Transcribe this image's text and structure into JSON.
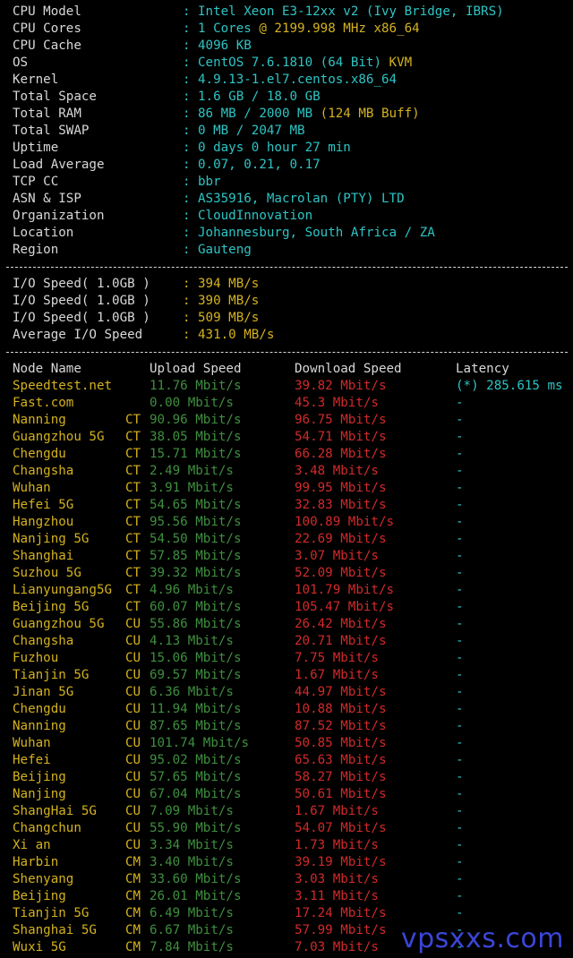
{
  "sysinfo": [
    {
      "key": "CPU Model",
      "value": "Intel Xeon E3-12xx v2 (Ivy Bridge, IBRS)",
      "extra": ""
    },
    {
      "key": "CPU Cores",
      "value": "1 Cores",
      "extra": "@ 2199.998 MHz x86_64"
    },
    {
      "key": "CPU Cache",
      "value": "4096 KB",
      "extra": ""
    },
    {
      "key": "OS",
      "value": "CentOS 7.6.1810 (64 Bit)",
      "extra": "KVM"
    },
    {
      "key": "Kernel",
      "value": "4.9.13-1.el7.centos.x86_64",
      "extra": ""
    },
    {
      "key": "Total Space",
      "value": "1.6 GB / 18.0 GB",
      "extra": ""
    },
    {
      "key": "Total RAM",
      "value": "86 MB / 2000 MB",
      "extra": "(124 MB Buff)"
    },
    {
      "key": "Total SWAP",
      "value": "0 MB / 2047 MB",
      "extra": ""
    },
    {
      "key": "Uptime",
      "value": "0 days 0 hour 27 min",
      "extra": ""
    },
    {
      "key": "Load Average",
      "value": "0.07, 0.21, 0.17",
      "extra": ""
    },
    {
      "key": "TCP CC",
      "value": "bbr",
      "extra": ""
    },
    {
      "key": "ASN & ISP",
      "value": "AS35916, Macrolan (PTY) LTD",
      "extra": ""
    },
    {
      "key": "Organization",
      "value": "CloudInnovation",
      "extra": ""
    },
    {
      "key": "Location",
      "value": "Johannesburg, South Africa / ZA",
      "extra": ""
    },
    {
      "key": "Region",
      "value": "Gauteng",
      "extra": ""
    }
  ],
  "io": [
    {
      "key": "I/O Speed( 1.0GB )",
      "value": "394 MB/s"
    },
    {
      "key": "I/O Speed( 1.0GB )",
      "value": "390 MB/s"
    },
    {
      "key": "I/O Speed( 1.0GB )",
      "value": "509 MB/s"
    },
    {
      "key": "Average I/O Speed",
      "value": "431.0 MB/s"
    }
  ],
  "separator": ":",
  "speed_headers": {
    "node": "Node Name",
    "upload": "Upload Speed",
    "download": "Download Speed",
    "latency": "Latency"
  },
  "speed_rows": [
    {
      "node": "Speedtest.net",
      "isp": "",
      "up": "11.76 Mbit/s",
      "down": "39.82 Mbit/s",
      "lat": "(*) 285.615 ms"
    },
    {
      "node": "Fast.com",
      "isp": "",
      "up": "0.00 Mbit/s",
      "down": "45.3 Mbit/s",
      "lat": "-"
    },
    {
      "node": "Nanning",
      "isp": "CT",
      "up": "90.96 Mbit/s",
      "down": "96.75 Mbit/s",
      "lat": "-"
    },
    {
      "node": "Guangzhou 5G",
      "isp": "CT",
      "up": "38.05 Mbit/s",
      "down": "54.71 Mbit/s",
      "lat": "-"
    },
    {
      "node": "Chengdu",
      "isp": "CT",
      "up": "15.71 Mbit/s",
      "down": "66.28 Mbit/s",
      "lat": "-"
    },
    {
      "node": "Changsha",
      "isp": "CT",
      "up": "2.49 Mbit/s",
      "down": "3.48 Mbit/s",
      "lat": "-"
    },
    {
      "node": "Wuhan",
      "isp": "CT",
      "up": "3.91 Mbit/s",
      "down": "99.95 Mbit/s",
      "lat": "-"
    },
    {
      "node": "Hefei 5G",
      "isp": "CT",
      "up": "54.65 Mbit/s",
      "down": "32.83 Mbit/s",
      "lat": "-"
    },
    {
      "node": "Hangzhou",
      "isp": "CT",
      "up": "95.56 Mbit/s",
      "down": "100.89 Mbit/s",
      "lat": "-"
    },
    {
      "node": "Nanjing 5G",
      "isp": "CT",
      "up": "54.50 Mbit/s",
      "down": "22.69 Mbit/s",
      "lat": "-"
    },
    {
      "node": "Shanghai",
      "isp": "CT",
      "up": "57.85 Mbit/s",
      "down": "3.07 Mbit/s",
      "lat": "-"
    },
    {
      "node": "Suzhou 5G",
      "isp": "CT",
      "up": "39.32 Mbit/s",
      "down": "52.09 Mbit/s",
      "lat": "-"
    },
    {
      "node": "Lianyungang5G",
      "isp": "CT",
      "up": "4.96 Mbit/s",
      "down": "101.79 Mbit/s",
      "lat": "-"
    },
    {
      "node": "Beijing 5G",
      "isp": "CT",
      "up": "60.07 Mbit/s",
      "down": "105.47 Mbit/s",
      "lat": "-"
    },
    {
      "node": "Guangzhou 5G",
      "isp": "CU",
      "up": "55.86 Mbit/s",
      "down": "26.42 Mbit/s",
      "lat": "-"
    },
    {
      "node": "Changsha",
      "isp": "CU",
      "up": "4.13 Mbit/s",
      "down": "20.71 Mbit/s",
      "lat": "-"
    },
    {
      "node": "Fuzhou",
      "isp": "CU",
      "up": "15.06 Mbit/s",
      "down": "7.75 Mbit/s",
      "lat": "-"
    },
    {
      "node": "Tianjin 5G",
      "isp": "CU",
      "up": "69.57 Mbit/s",
      "down": "1.67 Mbit/s",
      "lat": "-"
    },
    {
      "node": "Jinan 5G",
      "isp": "CU",
      "up": "6.36 Mbit/s",
      "down": "44.97 Mbit/s",
      "lat": "-"
    },
    {
      "node": "Chengdu",
      "isp": "CU",
      "up": "11.94 Mbit/s",
      "down": "10.88 Mbit/s",
      "lat": "-"
    },
    {
      "node": "Nanning",
      "isp": "CU",
      "up": "87.65 Mbit/s",
      "down": "87.52 Mbit/s",
      "lat": "-"
    },
    {
      "node": "Wuhan",
      "isp": "CU",
      "up": "101.74 Mbit/s",
      "down": "50.85 Mbit/s",
      "lat": "-"
    },
    {
      "node": "Hefei",
      "isp": "CU",
      "up": "95.02 Mbit/s",
      "down": "65.63 Mbit/s",
      "lat": "-"
    },
    {
      "node": "Beijing",
      "isp": "CU",
      "up": "57.65 Mbit/s",
      "down": "58.27 Mbit/s",
      "lat": "-"
    },
    {
      "node": "Nanjing",
      "isp": "CU",
      "up": "67.04 Mbit/s",
      "down": "50.61 Mbit/s",
      "lat": "-"
    },
    {
      "node": "ShangHai 5G",
      "isp": "CU",
      "up": "7.09 Mbit/s",
      "down": "1.67 Mbit/s",
      "lat": "-"
    },
    {
      "node": "Changchun",
      "isp": "CU",
      "up": "55.90 Mbit/s",
      "down": "54.07 Mbit/s",
      "lat": "-"
    },
    {
      "node": "Xi an",
      "isp": "CU",
      "up": "3.34 Mbit/s",
      "down": "1.73 Mbit/s",
      "lat": "-"
    },
    {
      "node": "Harbin",
      "isp": "CM",
      "up": "3.40 Mbit/s",
      "down": "39.19 Mbit/s",
      "lat": "-"
    },
    {
      "node": "Shenyang",
      "isp": "CM",
      "up": "33.60 Mbit/s",
      "down": "3.03 Mbit/s",
      "lat": "-"
    },
    {
      "node": "Beijing",
      "isp": "CM",
      "up": "26.01 Mbit/s",
      "down": "3.11 Mbit/s",
      "lat": "-"
    },
    {
      "node": "Tianjin 5G",
      "isp": "CM",
      "up": "6.49 Mbit/s",
      "down": "17.24 Mbit/s",
      "lat": "-"
    },
    {
      "node": "Shanghai 5G",
      "isp": "CM",
      "up": "6.67 Mbit/s",
      "down": "57.99 Mbit/s",
      "lat": "-"
    },
    {
      "node": "Wuxi 5G",
      "isp": "CM",
      "up": "7.84 Mbit/s",
      "down": "7.03 Mbit/s",
      "lat": "-"
    }
  ],
  "watermark": "vpsxxs.com",
  "colors": {
    "cyan": "#2ec4c4",
    "yellow": "#d4b21f",
    "green": "#3f8f3f",
    "red": "#d12a2a",
    "watermark": "#3b46d8"
  }
}
